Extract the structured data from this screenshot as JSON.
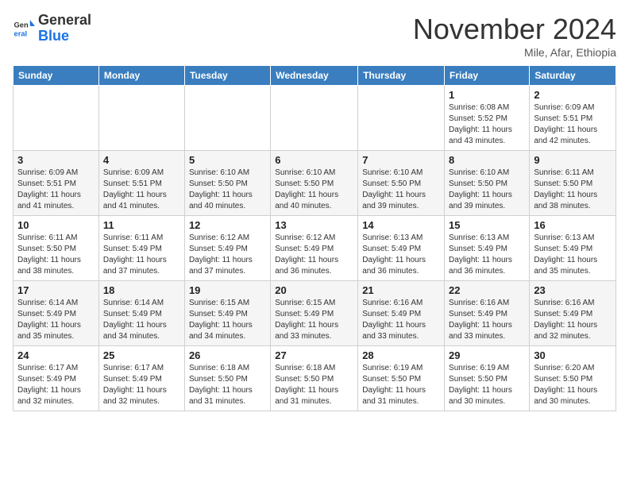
{
  "logo": {
    "line1": "General",
    "line2": "Blue"
  },
  "title": "November 2024",
  "location": "Mile, Afar, Ethiopia",
  "header_days": [
    "Sunday",
    "Monday",
    "Tuesday",
    "Wednesday",
    "Thursday",
    "Friday",
    "Saturday"
  ],
  "weeks": [
    [
      {
        "day": "",
        "info": ""
      },
      {
        "day": "",
        "info": ""
      },
      {
        "day": "",
        "info": ""
      },
      {
        "day": "",
        "info": ""
      },
      {
        "day": "",
        "info": ""
      },
      {
        "day": "1",
        "info": "Sunrise: 6:08 AM\nSunset: 5:52 PM\nDaylight: 11 hours and 43 minutes."
      },
      {
        "day": "2",
        "info": "Sunrise: 6:09 AM\nSunset: 5:51 PM\nDaylight: 11 hours and 42 minutes."
      }
    ],
    [
      {
        "day": "3",
        "info": "Sunrise: 6:09 AM\nSunset: 5:51 PM\nDaylight: 11 hours and 41 minutes."
      },
      {
        "day": "4",
        "info": "Sunrise: 6:09 AM\nSunset: 5:51 PM\nDaylight: 11 hours and 41 minutes."
      },
      {
        "day": "5",
        "info": "Sunrise: 6:10 AM\nSunset: 5:50 PM\nDaylight: 11 hours and 40 minutes."
      },
      {
        "day": "6",
        "info": "Sunrise: 6:10 AM\nSunset: 5:50 PM\nDaylight: 11 hours and 40 minutes."
      },
      {
        "day": "7",
        "info": "Sunrise: 6:10 AM\nSunset: 5:50 PM\nDaylight: 11 hours and 39 minutes."
      },
      {
        "day": "8",
        "info": "Sunrise: 6:10 AM\nSunset: 5:50 PM\nDaylight: 11 hours and 39 minutes."
      },
      {
        "day": "9",
        "info": "Sunrise: 6:11 AM\nSunset: 5:50 PM\nDaylight: 11 hours and 38 minutes."
      }
    ],
    [
      {
        "day": "10",
        "info": "Sunrise: 6:11 AM\nSunset: 5:50 PM\nDaylight: 11 hours and 38 minutes."
      },
      {
        "day": "11",
        "info": "Sunrise: 6:11 AM\nSunset: 5:49 PM\nDaylight: 11 hours and 37 minutes."
      },
      {
        "day": "12",
        "info": "Sunrise: 6:12 AM\nSunset: 5:49 PM\nDaylight: 11 hours and 37 minutes."
      },
      {
        "day": "13",
        "info": "Sunrise: 6:12 AM\nSunset: 5:49 PM\nDaylight: 11 hours and 36 minutes."
      },
      {
        "day": "14",
        "info": "Sunrise: 6:13 AM\nSunset: 5:49 PM\nDaylight: 11 hours and 36 minutes."
      },
      {
        "day": "15",
        "info": "Sunrise: 6:13 AM\nSunset: 5:49 PM\nDaylight: 11 hours and 36 minutes."
      },
      {
        "day": "16",
        "info": "Sunrise: 6:13 AM\nSunset: 5:49 PM\nDaylight: 11 hours and 35 minutes."
      }
    ],
    [
      {
        "day": "17",
        "info": "Sunrise: 6:14 AM\nSunset: 5:49 PM\nDaylight: 11 hours and 35 minutes."
      },
      {
        "day": "18",
        "info": "Sunrise: 6:14 AM\nSunset: 5:49 PM\nDaylight: 11 hours and 34 minutes."
      },
      {
        "day": "19",
        "info": "Sunrise: 6:15 AM\nSunset: 5:49 PM\nDaylight: 11 hours and 34 minutes."
      },
      {
        "day": "20",
        "info": "Sunrise: 6:15 AM\nSunset: 5:49 PM\nDaylight: 11 hours and 33 minutes."
      },
      {
        "day": "21",
        "info": "Sunrise: 6:16 AM\nSunset: 5:49 PM\nDaylight: 11 hours and 33 minutes."
      },
      {
        "day": "22",
        "info": "Sunrise: 6:16 AM\nSunset: 5:49 PM\nDaylight: 11 hours and 33 minutes."
      },
      {
        "day": "23",
        "info": "Sunrise: 6:16 AM\nSunset: 5:49 PM\nDaylight: 11 hours and 32 minutes."
      }
    ],
    [
      {
        "day": "24",
        "info": "Sunrise: 6:17 AM\nSunset: 5:49 PM\nDaylight: 11 hours and 32 minutes."
      },
      {
        "day": "25",
        "info": "Sunrise: 6:17 AM\nSunset: 5:49 PM\nDaylight: 11 hours and 32 minutes."
      },
      {
        "day": "26",
        "info": "Sunrise: 6:18 AM\nSunset: 5:50 PM\nDaylight: 11 hours and 31 minutes."
      },
      {
        "day": "27",
        "info": "Sunrise: 6:18 AM\nSunset: 5:50 PM\nDaylight: 11 hours and 31 minutes."
      },
      {
        "day": "28",
        "info": "Sunrise: 6:19 AM\nSunset: 5:50 PM\nDaylight: 11 hours and 31 minutes."
      },
      {
        "day": "29",
        "info": "Sunrise: 6:19 AM\nSunset: 5:50 PM\nDaylight: 11 hours and 30 minutes."
      },
      {
        "day": "30",
        "info": "Sunrise: 6:20 AM\nSunset: 5:50 PM\nDaylight: 11 hours and 30 minutes."
      }
    ]
  ]
}
